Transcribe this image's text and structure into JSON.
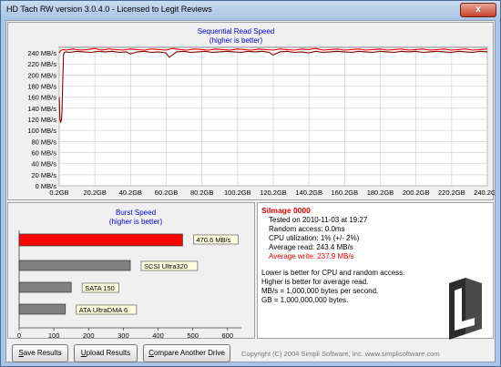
{
  "window": {
    "title": "HD Tach RW version 3.0.4.0 - Licensed to Legit Reviews",
    "close_label": "x"
  },
  "seq_chart": {
    "title": "Sequential Read Speed",
    "subtitle": "(higher is better)"
  },
  "burst_chart": {
    "title": "Burst Speed",
    "subtitle": "(higher is better)"
  },
  "info": {
    "drive_name": "SiImage 0000",
    "tested_on": "Tested on 2010-11-03 at 19:27",
    "random_access": "Random access: 0.0ms",
    "cpu_utilization": "CPU utilization: 1% (+/- 2%)",
    "average_read": "Average read: 243.4 MB/s",
    "average_write": "Average write: 237.9 MB/s",
    "note1": "Lower is better for CPU and random access.",
    "note2": "Higher is better for average read.",
    "note3": "MB/s = 1,000,000 bytes per second.",
    "note4": "GB = 1,000,000,000 bytes."
  },
  "buttons": {
    "save_first": "S",
    "save_rest": "ave Results",
    "upload_first": "U",
    "upload_rest": "pload Results",
    "compare_first": "C",
    "compare_rest": "ompare Another Drive"
  },
  "footer": {
    "copyright": "Copyright (C) 2004 Simpli Software, Inc. www.simplisoftware.com"
  },
  "colors": {
    "read_line": "#8b0000",
    "write_line": "#ff0000",
    "burst_bar": "#ff0000",
    "reference_bar": "#808080"
  },
  "chart_data": [
    {
      "type": "line",
      "title": "Sequential Read Speed",
      "subtitle": "(higher is better)",
      "y_ticks": [
        "0 MB/s",
        "20 MB/s",
        "40 MB/s",
        "60 MB/s",
        "80 MB/s",
        "100 MB/s",
        "120 MB/s",
        "140 MB/s",
        "160 MB/s",
        "180 MB/s",
        "200 MB/s",
        "220 MB/s",
        "240 MB/s"
      ],
      "x_ticks": [
        "0.2GB",
        "20.2GB",
        "40.2GB",
        "60.2GB",
        "80.2GB",
        "100.2GB",
        "120.2GB",
        "140.2GB",
        "160.2GB",
        "180.2GB",
        "200.2GB",
        "220.2GB",
        "240.2GB"
      ],
      "xlim": [
        0.2,
        240.2
      ],
      "ylim": [
        0,
        250
      ],
      "grid": true,
      "series": [
        {
          "style": "read",
          "x": [
            0.2,
            0.6,
            1.0,
            1.4,
            1.8,
            2.2,
            2.6,
            3.0,
            4.0,
            6.0,
            10.0,
            14.0,
            18.0,
            22.0,
            26.0,
            30.0,
            34.0,
            38.0,
            40.0,
            44.0,
            48.0,
            52.0,
            56.0,
            60.0,
            62.0,
            66.0,
            70.0,
            74.0,
            78.0,
            82.0,
            86.0,
            90.0,
            94.0,
            98.0,
            102.0,
            106.0,
            110.0,
            114.0,
            118.0,
            120.0,
            124.0,
            128.0,
            132.0,
            136.0,
            140.0,
            144.0,
            148.0,
            152.0,
            156.0,
            160.0,
            164.0,
            168.0,
            172.0,
            176.0,
            180.0,
            184.0,
            188.0,
            192.0,
            196.0,
            200.0,
            204.0,
            208.0,
            212.0,
            216.0,
            220.0,
            224.0,
            228.0,
            232.0,
            236.0,
            240.2
          ],
          "y": [
            160,
            120,
            115,
            118,
            135,
            190,
            236,
            241,
            242,
            241,
            243,
            242,
            241,
            243,
            242,
            243,
            241,
            242,
            238,
            242,
            243,
            241,
            242,
            240,
            232,
            242,
            243,
            241,
            242,
            243,
            241,
            242,
            243,
            242,
            241,
            243,
            242,
            243,
            241,
            236,
            242,
            243,
            241,
            242,
            240,
            243,
            241,
            242,
            243,
            242,
            241,
            243,
            242,
            241,
            243,
            242,
            241,
            243,
            242,
            243,
            241,
            242,
            243,
            242,
            241,
            243,
            242,
            241,
            243,
            242
          ]
        },
        {
          "style": "write",
          "x": [
            0.2,
            1.0,
            2.0,
            4.0,
            8.0,
            12.0,
            16.0,
            20.0,
            24.0,
            28.0,
            32.0,
            36.0,
            40.0,
            44.0,
            48.0,
            52.0,
            56.0,
            60.0,
            64.0,
            68.0,
            72.0,
            76.0,
            80.0,
            84.0,
            88.0,
            92.0,
            96.0,
            100.0,
            104.0,
            108.0,
            112.0,
            116.0,
            120.0,
            124.0,
            128.0,
            132.0,
            136.0,
            140.0,
            144.0,
            148.0,
            152.0,
            156.0,
            160.0,
            164.0,
            168.0,
            172.0,
            176.0,
            180.0,
            184.0,
            188.0,
            192.0,
            196.0,
            200.0,
            204.0,
            208.0,
            212.0,
            216.0,
            220.0,
            224.0,
            228.0,
            232.0,
            236.0,
            240.2
          ],
          "y": [
            240,
            244,
            246,
            245,
            247,
            245,
            246,
            248,
            245,
            247,
            246,
            245,
            247,
            246,
            245,
            247,
            246,
            245,
            248,
            246,
            245,
            247,
            246,
            245,
            247,
            246,
            245,
            247,
            246,
            245,
            247,
            246,
            245,
            247,
            246,
            245,
            247,
            246,
            248,
            245,
            246,
            247,
            245,
            246,
            247,
            245,
            246,
            247,
            245,
            246,
            247,
            245,
            246,
            247,
            245,
            246,
            247,
            245,
            246,
            247,
            245,
            246,
            247
          ]
        }
      ]
    },
    {
      "type": "bar",
      "orientation": "horizontal",
      "title": "Burst Speed",
      "subtitle": "(higher is better)",
      "xlim": [
        0,
        640
      ],
      "x_ticks": [
        "0",
        "100",
        "200",
        "300",
        "400",
        "500",
        "600"
      ],
      "bars": [
        {
          "value": 470.6,
          "label": "470.6 MB/s",
          "color": "#ff0000"
        },
        {
          "value": 320,
          "label": "SCSI Ultra320",
          "color": "#808080"
        },
        {
          "value": 150,
          "label": "SATA 150",
          "color": "#808080"
        },
        {
          "value": 133,
          "label": "ATA UltraDMA 6",
          "color": "#808080"
        }
      ]
    }
  ]
}
